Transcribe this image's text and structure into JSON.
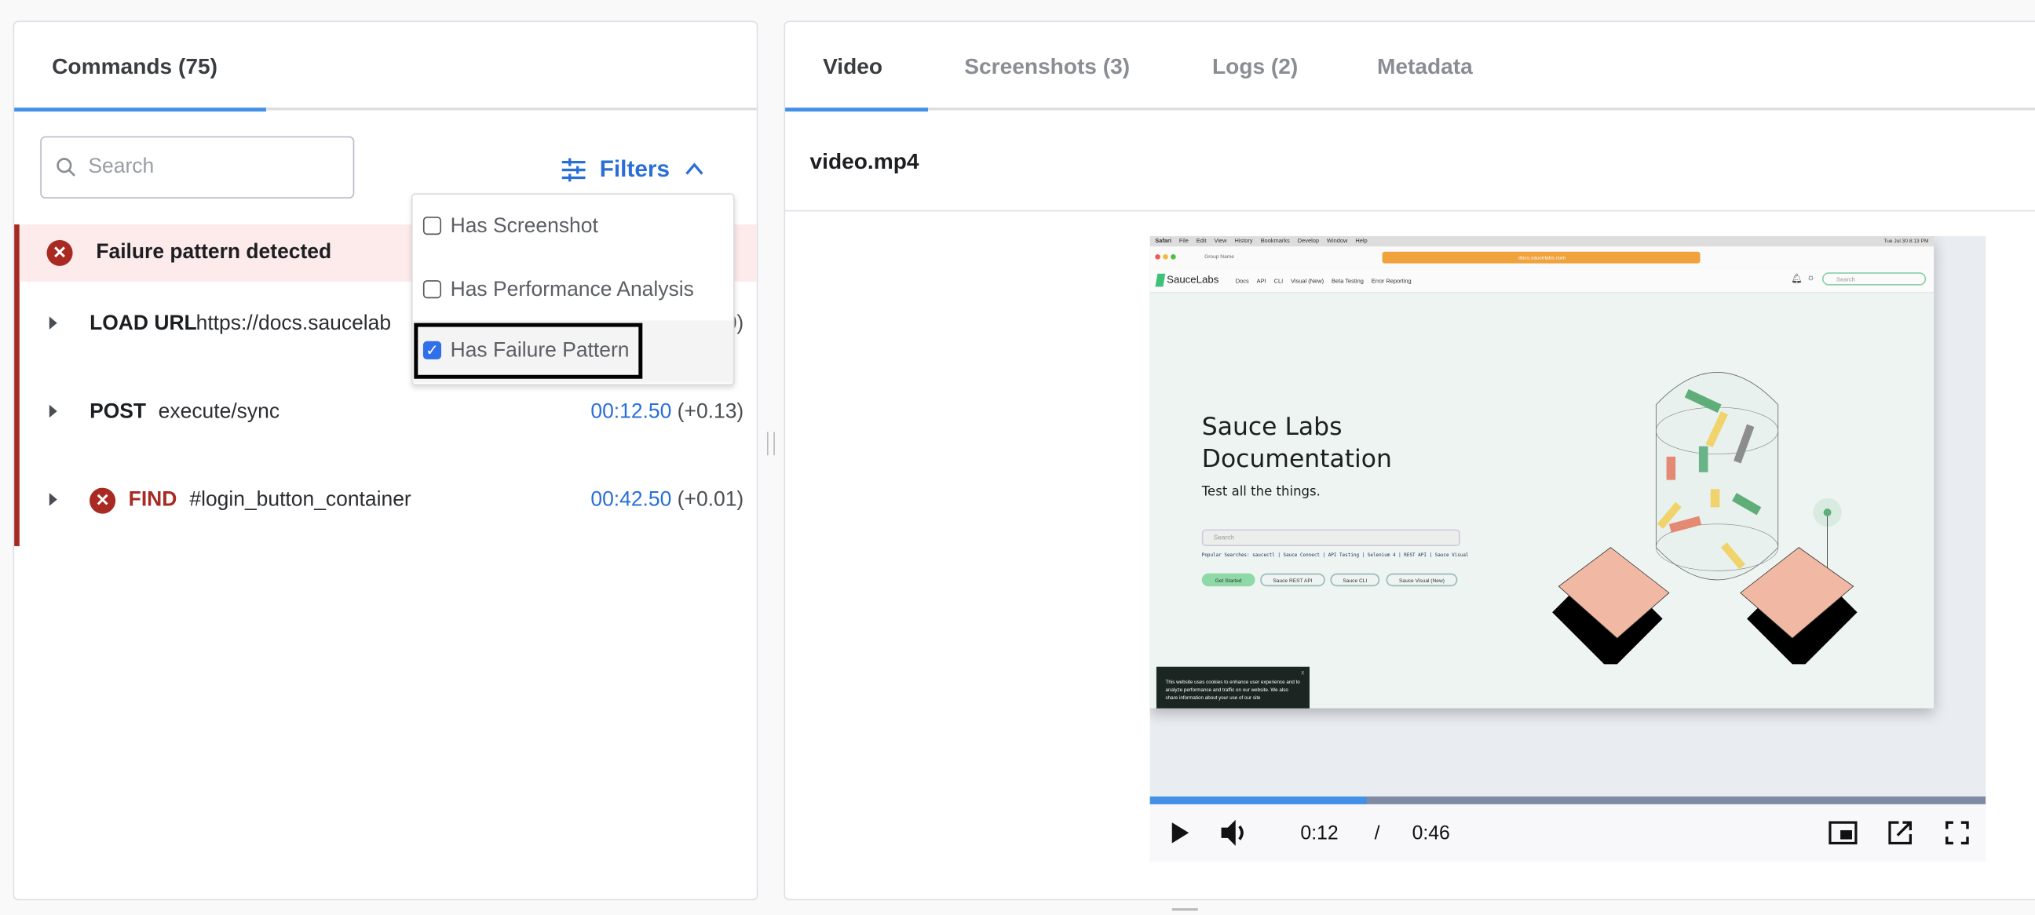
{
  "left_panel": {
    "tab": "Commands (75)",
    "search_placeholder": "Search",
    "filters_label": "Filters",
    "failure_banner": "Failure pattern detected",
    "filters_menu": [
      {
        "label": "Has Screenshot",
        "checked": false
      },
      {
        "label": "Has Performance Analysis",
        "checked": false
      },
      {
        "label": "Has Failure Pattern",
        "checked": true
      }
    ],
    "commands": [
      {
        "method": "LOAD URL",
        "arg": "https://docs.saucelab",
        "time": "",
        "delta": "0)",
        "error": false
      },
      {
        "method": "POST",
        "arg": "execute/sync",
        "time": "00:12.50",
        "delta": "(+0.13)",
        "error": false
      },
      {
        "method": "FIND",
        "arg": "#login_button_container",
        "time": "00:42.50",
        "delta": "(+0.01)",
        "error": true
      }
    ]
  },
  "right_panel": {
    "tabs": [
      {
        "label": "Video",
        "active": true
      },
      {
        "label": "Screenshots (3)",
        "active": false
      },
      {
        "label": "Logs (2)",
        "active": false
      },
      {
        "label": "Metadata",
        "active": false
      }
    ],
    "file_name": "video.mp4",
    "player": {
      "current": "0:12",
      "separator": "/",
      "duration": "0:46",
      "progress_fraction": 0.26
    },
    "frame": {
      "menubar": [
        "Safari",
        "File",
        "Edit",
        "View",
        "History",
        "Bookmarks",
        "Develop",
        "Window",
        "Help"
      ],
      "menubar_clock": "Tue Jul 30  8:13 PM",
      "group_name": "Group Name",
      "url": "docs.saucelabs.com",
      "logo": "SauceLabs",
      "nav": [
        "Docs",
        "API",
        "CLI",
        "Visual (New)",
        "Beta Testing",
        "Error Reporting"
      ],
      "nav_search": "Search",
      "hero_title_1": "Sauce Labs",
      "hero_title_2": "Documentation",
      "hero_subtitle": "Test all the things.",
      "hero_search": "Search",
      "popular": "Popular Searches:  saucectl | Sauce Connect | API Testing | Selenium 4 | REST API | Sauce Visual",
      "buttons": [
        "Get Started",
        "Sauce REST API",
        "Sauce CLI",
        "Sauce Visual (New)"
      ],
      "cookie_text": "This website uses cookies to enhance user experience and to analyze performance and traffic on our website. We also share information about your use of our site",
      "cookie_close": "x"
    }
  },
  "colors": {
    "accent": "#2a6fd6",
    "tab_underline": "#4391e6",
    "error": "#a82a22",
    "banner_bg": "#fdeaea"
  }
}
